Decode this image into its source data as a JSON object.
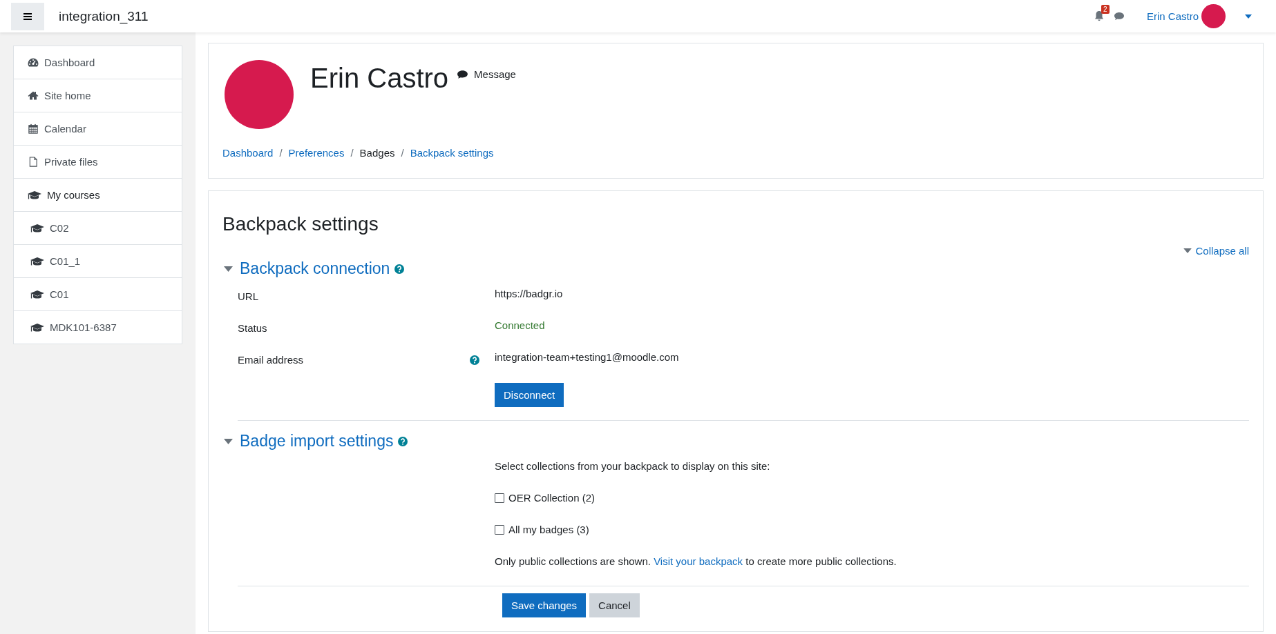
{
  "navbar": {
    "site_name": "integration_311",
    "notification_count": "2",
    "user_name": "Erin Castro"
  },
  "sidebar": {
    "items": [
      {
        "label": "Dashboard",
        "kind": "dashboard"
      },
      {
        "label": "Site home",
        "kind": "home"
      },
      {
        "label": "Calendar",
        "kind": "calendar"
      },
      {
        "label": "Private files",
        "kind": "file"
      },
      {
        "label": "My courses",
        "kind": "courses",
        "children": [
          {
            "label": "C02",
            "kind": "course"
          },
          {
            "label": "C01_1",
            "kind": "course"
          },
          {
            "label": "C01",
            "kind": "course"
          },
          {
            "label": "MDK101-6387",
            "kind": "course"
          }
        ]
      }
    ]
  },
  "profile": {
    "name": "Erin Castro",
    "message_label": "Message"
  },
  "breadcrumb": [
    {
      "label": "Dashboard",
      "link": true
    },
    {
      "separator": "/"
    },
    {
      "label": "Preferences",
      "link": true
    },
    {
      "separator": "/"
    },
    {
      "label": "Badges",
      "link": false
    },
    {
      "separator": "/"
    },
    {
      "label": "Backpack settings",
      "link": true
    }
  ],
  "page_title": "Backpack settings",
  "collapse_all": "Collapse all",
  "sections": [
    {
      "title": "Backpack connection",
      "expanded": true,
      "rows": [
        {
          "kind": "static",
          "label": "URL",
          "value": "https://badgr.io"
        },
        {
          "kind": "status",
          "label": "Status",
          "value": "Connected"
        },
        {
          "kind": "static",
          "label": "Email address",
          "value": "integration-team+testing1@moodle.com",
          "help": true
        },
        {
          "kind": "button",
          "label_button": "Disconnect"
        }
      ]
    },
    {
      "title": "Badge import settings",
      "expanded": true,
      "rows": [
        {
          "kind": "text",
          "value": "Select collections from your backpack to display on this site:"
        },
        {
          "kind": "checkbox",
          "value": "OER Collection (2)",
          "checked": false
        },
        {
          "kind": "checkbox",
          "value": "All my badges (3)",
          "checked": false
        },
        {
          "kind": "note",
          "before": "Only public collections are shown. ",
          "link": "Visit your backpack",
          "after": " to create more public collections."
        }
      ]
    }
  ],
  "buttons": [
    {
      "label": "Save changes",
      "primary": true
    },
    {
      "label": "Cancel",
      "primary": false
    }
  ]
}
